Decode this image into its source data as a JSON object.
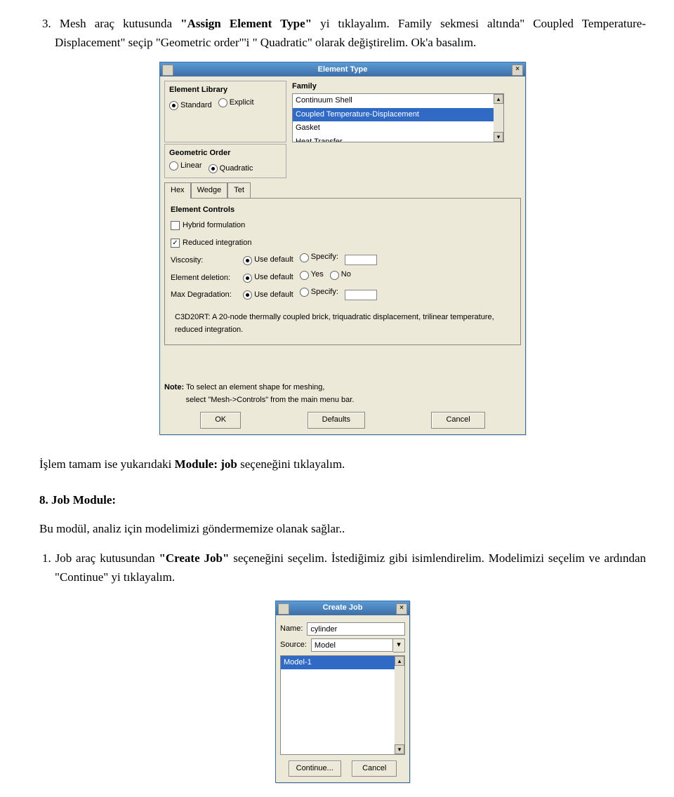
{
  "para1_prefix": "3. Mesh araç kutusunda ",
  "para1_bold": "\"Assign Element Type\"",
  "para1_suffix": " yi tıklayalım. Family sekmesi altında\" Coupled Temperature- Displacement\" seçip \"Geometric order\"'i \" Quadratic\" olarak değiştirelim. Ok'a basalım.",
  "elementType": {
    "title": "Element Type",
    "lib_label": "Element Library",
    "lib_std": "Standard",
    "lib_exp": "Explicit",
    "geom_label": "Geometric Order",
    "geom_lin": "Linear",
    "geom_quad": "Quadratic",
    "family_label": "Family",
    "family_items": {
      "a": "Continuum Shell",
      "b": "Coupled Temperature-Displacement",
      "c": "Gasket",
      "d": "Heat Transfer"
    },
    "tab_hex": "Hex",
    "tab_wedge": "Wedge",
    "tab_tet": "Tet",
    "ec_title": "Element Controls",
    "hybrid": "Hybrid formulation",
    "reduced": "Reduced integration",
    "visc": "Viscosity:",
    "elemdel": "Element deletion:",
    "maxdeg": "Max Degradation:",
    "use_default": "Use default",
    "specify": "Specify:",
    "yes": "Yes",
    "no": "No",
    "desc": "C3D20RT: A 20-node thermally coupled brick, triquadratic displacement, trilinear temperature, reduced integration.",
    "note_bold": "Note:",
    "note_l1": "  To select an element shape for meshing,",
    "note_l2": "select \"Mesh->Controls\" from the main menu bar.",
    "btn_ok": "OK",
    "btn_defaults": "Defaults",
    "btn_cancel": "Cancel"
  },
  "para2_prefix": "İşlem tamam ise yukarıdaki ",
  "para2_bold": "Module: job",
  "para2_suffix": " seçeneğini tıklayalım.",
  "para3_bold": "8. Job Module:",
  "para4": "Bu modül, analiz için modelimizi göndermemize olanak sağlar..",
  "para5_prefix": "1. Job araç kutusundan ",
  "para5_bold": "\"Create Job\"",
  "para5_suffix": " seçeneğini seçelim. İstediğimiz gibi isimlendirelim. Modelimizi seçelim ve ardından \"Continue\" yi tıklayalım.",
  "createJob": {
    "title": "Create Job",
    "name_label": "Name:",
    "name_value": "cylinder",
    "source_label": "Source:",
    "source_value": "Model",
    "list_item": "Model-1",
    "btn_continue": "Continue...",
    "btn_cancel": "Cancel"
  }
}
